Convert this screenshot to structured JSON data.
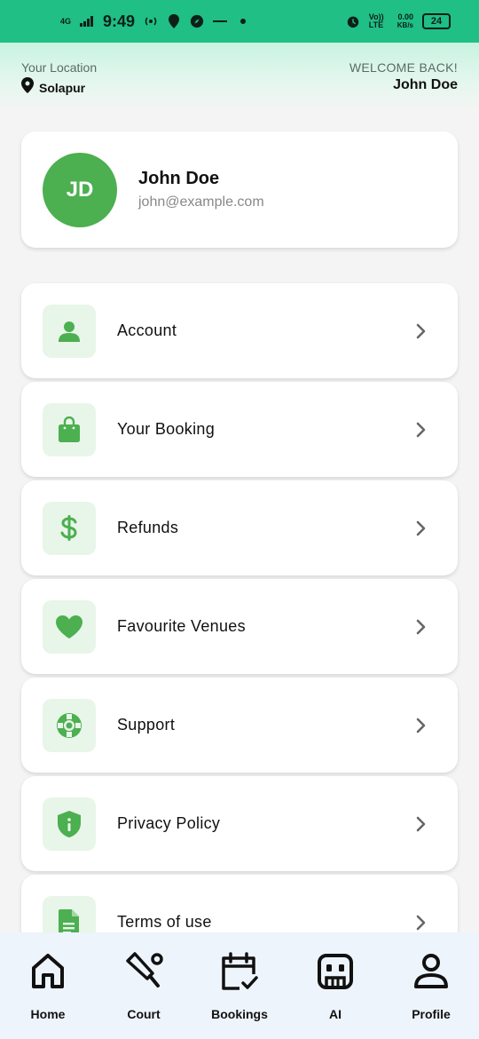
{
  "status_bar": {
    "network": "4G",
    "time": "9:49",
    "volte": "Vo)) LTE",
    "speed_value": "0.00",
    "speed_unit": "KB/s",
    "battery": "24"
  },
  "header": {
    "location_label": "Your Location",
    "location_city": "Solapur",
    "welcome_label": "WELCOME BACK!",
    "welcome_name": "John Doe"
  },
  "profile": {
    "initials": "JD",
    "name": "John Doe",
    "email": "john@example.com"
  },
  "menu": [
    {
      "label": "Account",
      "icon": "person-icon"
    },
    {
      "label": "Your Booking",
      "icon": "shopping-bag-icon"
    },
    {
      "label": "Refunds",
      "icon": "dollar-icon"
    },
    {
      "label": "Favourite Venues",
      "icon": "heart-icon"
    },
    {
      "label": "Support",
      "icon": "lifebuoy-icon"
    },
    {
      "label": "Privacy Policy",
      "icon": "shield-icon"
    },
    {
      "label": "Terms of use",
      "icon": "document-icon"
    }
  ],
  "bottom_nav": [
    {
      "label": "Home",
      "icon": "home-icon"
    },
    {
      "label": "Court",
      "icon": "cricket-bat-icon"
    },
    {
      "label": "Bookings",
      "icon": "calendar-check-icon"
    },
    {
      "label": "AI",
      "icon": "robot-icon"
    },
    {
      "label": "Profile",
      "icon": "person-outline-icon"
    }
  ],
  "colors": {
    "status_bar": "#1fbf85",
    "accent_green": "#4caf50",
    "icon_bg": "#e8f5e9",
    "nav_bg": "#eef4fb"
  }
}
